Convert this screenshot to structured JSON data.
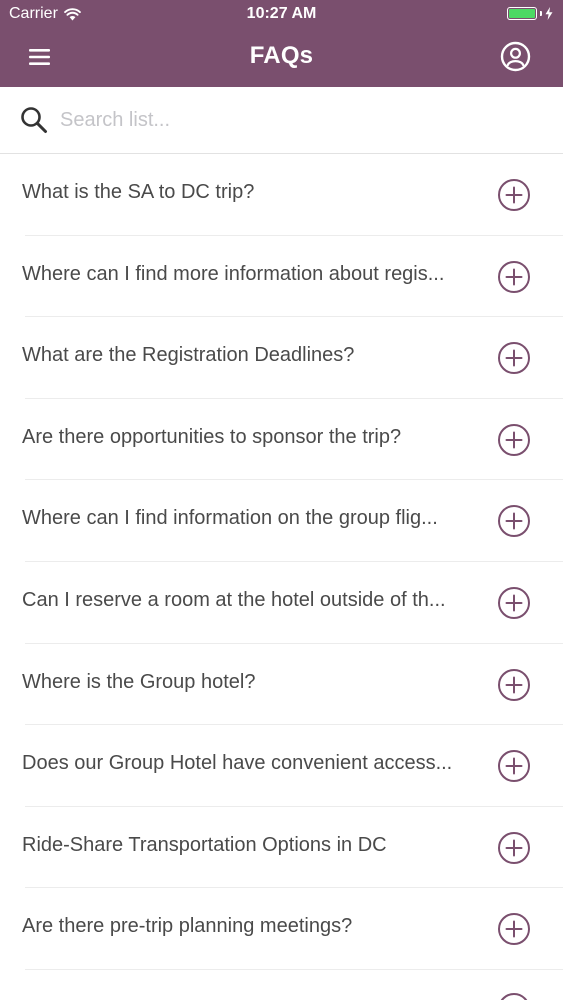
{
  "status_bar": {
    "carrier": "Carrier",
    "time": "10:27 AM"
  },
  "header": {
    "title": "FAQs",
    "menu_icon": "hamburger-menu-icon",
    "profile_icon": "user-circle-icon",
    "background_color": "#7a4f6e"
  },
  "search": {
    "placeholder": "Search list...",
    "icon": "search-icon"
  },
  "faqs": [
    {
      "question": "What is the SA to DC trip?"
    },
    {
      "question": "Where can I find more information about regis..."
    },
    {
      "question": "What are the Registration Deadlines?"
    },
    {
      "question": "Are there opportunities to sponsor the trip?"
    },
    {
      "question": "Where can I find information on the group flig..."
    },
    {
      "question": "Can I reserve a room at the hotel outside of th..."
    },
    {
      "question": "Where is the Group hotel?"
    },
    {
      "question": "Does our Group Hotel have convenient access..."
    },
    {
      "question": "Ride-Share Transportation Options in DC"
    },
    {
      "question": "Are there pre-trip planning meetings?"
    }
  ],
  "colors": {
    "accent": "#7a4f6e",
    "text": "#4a4a4a",
    "battery": "#4cd964"
  }
}
